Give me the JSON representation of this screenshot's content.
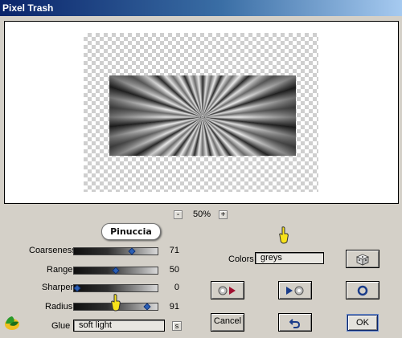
{
  "window": {
    "title": "Pixel Trash"
  },
  "zoom": {
    "minus": "-",
    "value": "50%",
    "plus": "+"
  },
  "logo": {
    "text": "Pinuccia"
  },
  "sliders": [
    {
      "label": "Coarseness",
      "value": "71",
      "fraction": 0.71
    },
    {
      "label": "Range",
      "value": "50",
      "fraction": 0.5
    },
    {
      "label": "Sharpen",
      "value": "0",
      "fraction": 0.0
    },
    {
      "label": "Radius",
      "value": "91",
      "fraction": 0.91
    }
  ],
  "glue": {
    "label": "Glue",
    "value": "soft light",
    "toggle": "s"
  },
  "colors": {
    "label": "Colors",
    "value": "greys"
  },
  "buttons": {
    "cancel": "Cancel",
    "ok": "OK"
  },
  "icons": {
    "dice": "dice-icon",
    "undo": "undo-icon",
    "circle": "circle-icon",
    "prev": "prev-preset-icon",
    "next": "next-preset-icon",
    "app": "app-logo-icon",
    "hand": "pointing-hand-icon"
  }
}
